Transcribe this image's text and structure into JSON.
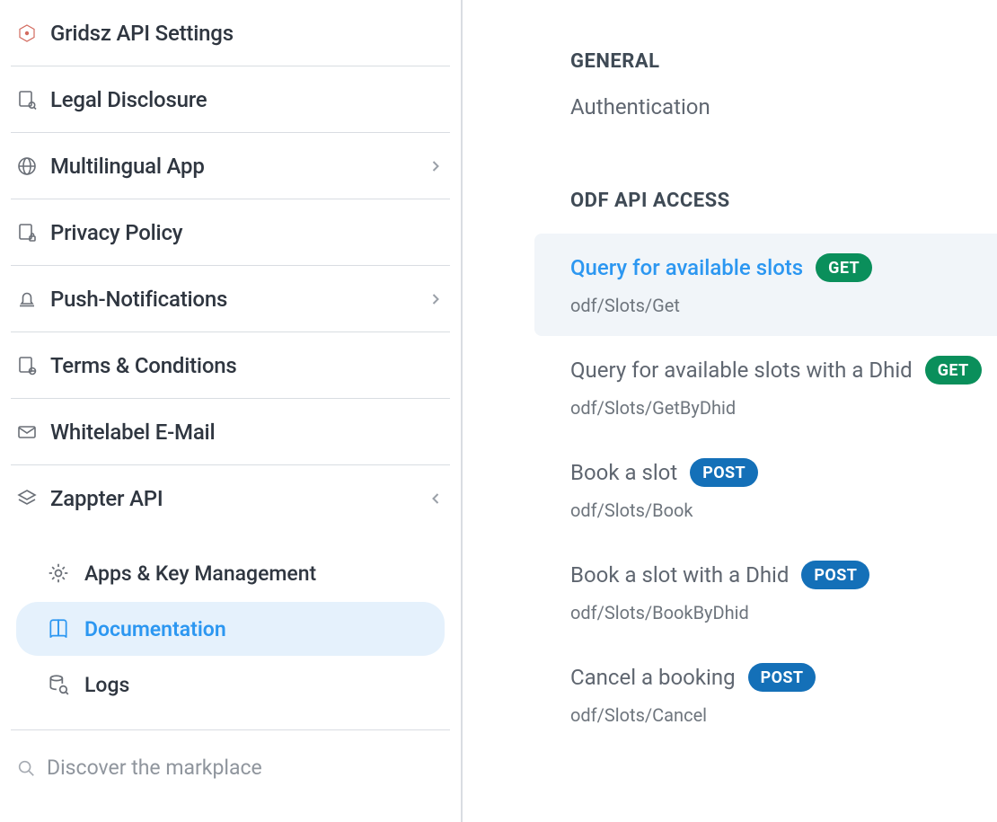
{
  "sidebar": {
    "items": [
      {
        "id": "gridsz-api-settings",
        "label": "Gridsz API Settings",
        "icon": "hex-dot",
        "expandable": false
      },
      {
        "id": "legal-disclosure",
        "label": "Legal Disclosure",
        "icon": "doc-search",
        "expandable": false
      },
      {
        "id": "multilingual-app",
        "label": "Multilingual App",
        "icon": "globe",
        "expandable": true,
        "expanded": false
      },
      {
        "id": "privacy-policy",
        "label": "Privacy Policy",
        "icon": "doc-lock",
        "expandable": false
      },
      {
        "id": "push-notifications",
        "label": "Push-Notifications",
        "icon": "bell",
        "expandable": true,
        "expanded": false
      },
      {
        "id": "terms-conditions",
        "label": "Terms & Conditions",
        "icon": "doc-globe",
        "expandable": false
      },
      {
        "id": "whitelabel-email",
        "label": "Whitelabel E-Mail",
        "icon": "envelope",
        "expandable": false
      },
      {
        "id": "zappter-api",
        "label": "Zappter API",
        "icon": "stack",
        "expandable": true,
        "expanded": true,
        "children": [
          {
            "id": "apps-key-management",
            "label": "Apps & Key Management",
            "icon": "gear",
            "active": false
          },
          {
            "id": "documentation",
            "label": "Documentation",
            "icon": "book",
            "active": true
          },
          {
            "id": "logs",
            "label": "Logs",
            "icon": "db-search",
            "active": false
          }
        ]
      }
    ],
    "discover_label": "Discover the markplace"
  },
  "panel": {
    "sections": [
      {
        "heading": "GENERAL",
        "items": [
          {
            "type": "link",
            "title": "Authentication"
          }
        ]
      },
      {
        "heading": "ODF API ACCESS",
        "items": [
          {
            "type": "endpoint",
            "title": "Query for available slots",
            "method": "GET",
            "path": "odf/Slots/Get",
            "selected": true
          },
          {
            "type": "endpoint",
            "title": "Query for available slots with a Dhid",
            "method": "GET",
            "path": "odf/Slots/GetByDhid",
            "selected": false
          },
          {
            "type": "endpoint",
            "title": "Book a slot",
            "method": "POST",
            "path": "odf/Slots/Book",
            "selected": false
          },
          {
            "type": "endpoint",
            "title": "Book a slot with a Dhid",
            "method": "POST",
            "path": "odf/Slots/BookByDhid",
            "selected": false
          },
          {
            "type": "endpoint",
            "title": "Cancel a booking",
            "method": "POST",
            "path": "odf/Slots/Cancel",
            "selected": false
          }
        ]
      }
    ]
  }
}
